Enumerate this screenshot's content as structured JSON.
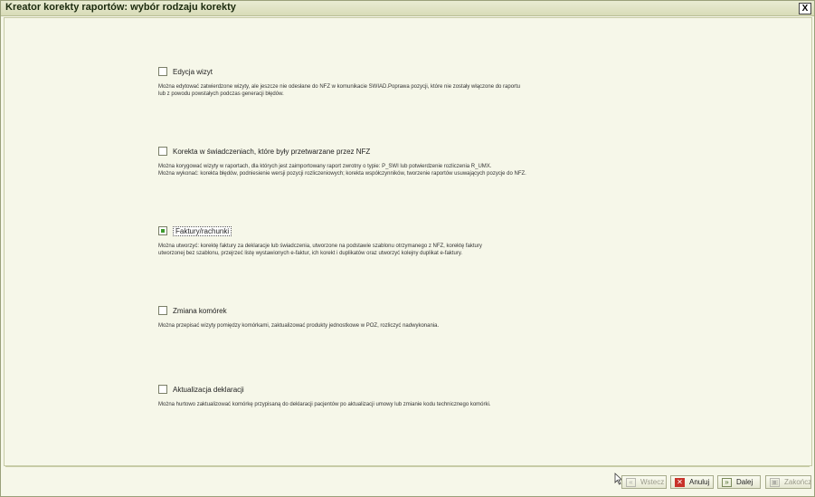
{
  "window": {
    "title": "Kreator korekty raportów: wybór rodzaju korekty",
    "close_label": "X"
  },
  "options": [
    {
      "label": "Edycja wizyt",
      "checked": false,
      "description": "Można edytować zatwierdzone wizyty, ale jeszcze nie odesłane do NFZ w komunikacie SWIAD.Poprawa pozycji, które nie zostały włączone do raportu\nlub z powodu powstałych podczas generacji błędów."
    },
    {
      "label": "Korekta w świadczeniach, które były przetwarzane przez NFZ",
      "checked": false,
      "description": "Można korygować wizyty w raportach, dla których jest zaimportowany raport zwrotny o typie: P_SWI lub potwierdzenie rozliczenia R_UMX.\nMożna wykonać: korekta błędów, podniesienie wersji pozycji rozliczeniowych; korekta współczynników, tworzenie raportów usuwających pozycje do NFZ."
    },
    {
      "label": "Faktury/rachunki",
      "checked": true,
      "description": "Można utworzyć: korektę faktury za deklaracje lub świadczenia, utworzone na podstawie szablonu otrzymanego z NFZ, korektę faktury\nutworzonej bez szablonu, przejrzeć listę wystawionych e-faktur, ich korekt i duplikatów oraz utworzyć kolejny duplikat e-faktury."
    },
    {
      "label": "Zmiana komórek",
      "checked": false,
      "description": "Można przepisać wizyty pomiędzy komórkami, zaktualizować produkty jednostkowe w POZ, rozliczyć nadwykonania."
    },
    {
      "label": "Aktualizacja deklaracji",
      "checked": false,
      "description": "Można hurtowo zaktualizować komórkę przypisaną do deklaracji pacjentów po aktualizacji umowy lub zmianie kodu technicznego komórki."
    }
  ],
  "buttons": {
    "prev": {
      "label": "Wstecz",
      "icon": "prev-icon",
      "enabled": false
    },
    "cancel": {
      "label": "Anuluj",
      "icon": "cancel-icon",
      "enabled": true
    },
    "next": {
      "label": "Dalej",
      "icon": "next-icon",
      "enabled": true
    },
    "finish": {
      "label": "Zakończ",
      "icon": "finish-icon",
      "enabled": false
    }
  },
  "colors": {
    "background": "#f6f7e9",
    "checked_mark": "#3c9a2c",
    "cancel_icon": "#c8322a"
  }
}
